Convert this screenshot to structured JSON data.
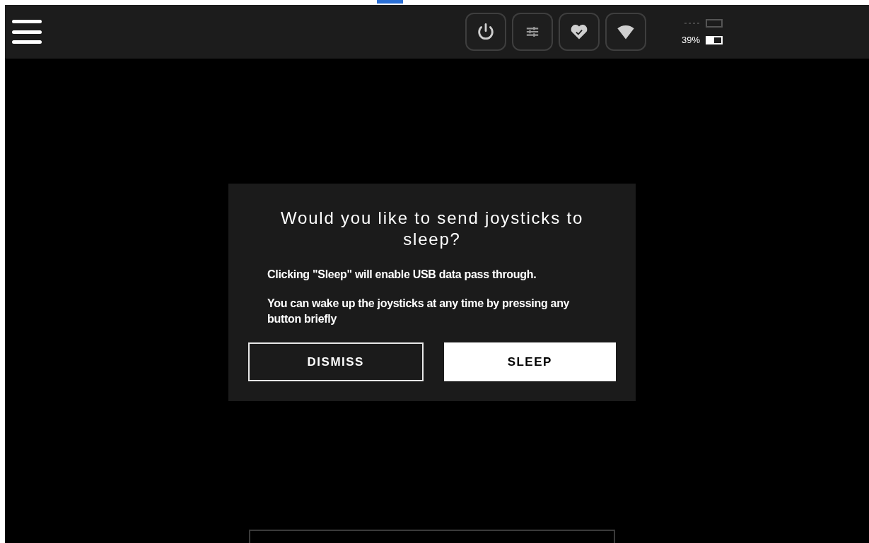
{
  "top_bar": {
    "toolbar": [
      {
        "kind": "power"
      },
      {
        "kind": "sliders"
      },
      {
        "kind": "heart"
      },
      {
        "kind": "wifi"
      }
    ],
    "batteries": [
      {
        "kind": "disconnected"
      },
      {
        "kind": "connected",
        "reading": "39%",
        "level": 0.5
      }
    ]
  },
  "dialog": {
    "title": "Would you like to send joysticks to sleep?",
    "paragraphs": [
      "Clicking \"Sleep\" will enable USB data pass through.",
      "You can wake up the joysticks at any time by pressing any button briefly"
    ],
    "buttons": [
      {
        "label": "DISMISS",
        "kind": "outline"
      },
      {
        "label": "SLEEP",
        "kind": "solid"
      }
    ]
  }
}
